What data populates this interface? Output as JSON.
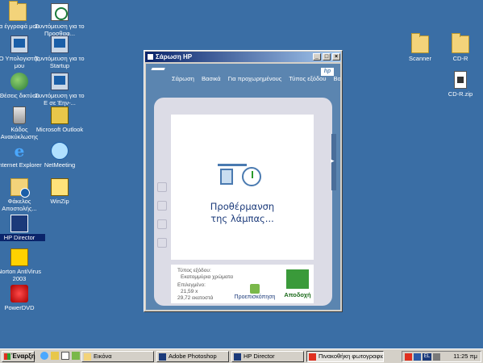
{
  "desktop": {
    "left_icons": [
      {
        "name": "my-documents",
        "label": "Τα έγγραφά μου",
        "icon": "folder-icon"
      },
      {
        "name": "my-computer",
        "label": "Ο Υπολογιστής μου",
        "icon": "computer-icon"
      },
      {
        "name": "network-places",
        "label": "Θέσεις δικτύου",
        "icon": "globe-icon"
      },
      {
        "name": "recycle-bin",
        "label": "Κάδος Ανακύκλωσης",
        "icon": "recycle-bin-icon"
      },
      {
        "name": "internet-explorer",
        "label": "Internet Explorer",
        "icon": "ie-icon"
      },
      {
        "name": "shared-scanner",
        "label": "Φάκελος Αποστολής...",
        "icon": "share-folder-icon"
      },
      {
        "name": "hp-director",
        "label": "HP Director",
        "icon": "hp-icon"
      },
      {
        "name": "norton-antivirus",
        "label": "Norton AntiVirus 2003",
        "icon": "norton-icon"
      },
      {
        "name": "powerdvd",
        "label": "PowerDVD",
        "icon": "powerdvd-icon"
      }
    ],
    "second_icons": [
      {
        "name": "shortcut-proshthaf",
        "label": "Συντόμευση για το Προσθαφ...",
        "icon": "sync-icon"
      },
      {
        "name": "shortcut-startup",
        "label": "Συντόμευση για το Startup",
        "icon": "shortcut-icon"
      },
      {
        "name": "shortcut-e",
        "label": "Συντόμευση για το Ε σε Έην-...",
        "icon": "drive-icon"
      },
      {
        "name": "outlook",
        "label": "Microsoft Outlook",
        "icon": "outlook-icon"
      },
      {
        "name": "netmeeting",
        "label": "NetMeeting",
        "icon": "netmeeting-icon"
      },
      {
        "name": "winzip",
        "label": "WinZip",
        "icon": "winzip-icon"
      }
    ],
    "right_icons": [
      {
        "name": "scanner",
        "label": "Scanner",
        "icon": "folder-icon"
      },
      {
        "name": "cd-r",
        "label": "CD-R",
        "icon": "folder-icon"
      },
      {
        "name": "cd-r-zip",
        "label": "CD-R.zip",
        "icon": "zip-file-icon"
      }
    ]
  },
  "hp_window": {
    "title": "Σάρωση HP",
    "controls": {
      "minimize": "_",
      "maximize": "□",
      "close": "×"
    },
    "tabs": [
      "Σάρωση",
      "Βασικά",
      "Για προχωρημένους",
      "Τύπος εξόδου",
      "Βοή"
    ],
    "logo": "hp",
    "status_line1": "Προθέρμανση",
    "status_line2": "της λάμπας...",
    "output_label": "Τύπος εξόδου:",
    "output_value": "Εκατομμύρια χρώματα",
    "selected_label": "Επιλεγμένο:",
    "selected_width": "21,59 x",
    "selected_height": "29,72 εκατοστά",
    "preview_button": "Προεπισκόπηση",
    "accept_button": "Αποδοχή"
  },
  "taskbar": {
    "start_label": "Έναρξη",
    "tasks": [
      {
        "label": "Εικόνα",
        "icon": "folder-icon",
        "active": false
      },
      {
        "label": "Adobe Photoshop",
        "icon": "photoshop-icon",
        "active": false
      },
      {
        "label": "HP Director",
        "icon": "hp-icon",
        "active": false
      },
      {
        "label": "Πινακοθήκη φωτογραφιώ...",
        "icon": "gallery-icon",
        "active": true
      }
    ],
    "language": "EL",
    "clock": "11:25 πμ"
  }
}
